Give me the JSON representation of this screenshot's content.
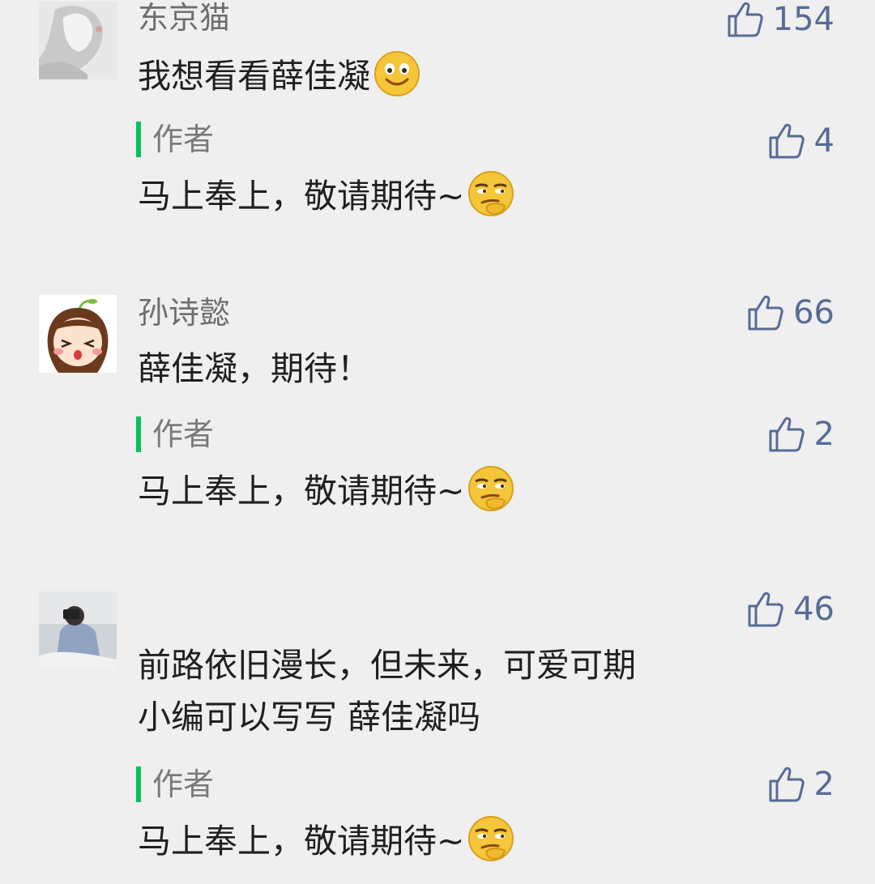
{
  "comments": [
    {
      "username": "东京猫",
      "likes": "154",
      "text": "我想看看薛佳凝",
      "emoji": "smile-emoji",
      "reply": {
        "label": "作者",
        "likes": "4",
        "text": "马上奉上，敬请期待~",
        "emoji": "smirk-emoji"
      }
    },
    {
      "username": "孙诗懿",
      "likes": "66",
      "text": "薛佳凝，期待！",
      "reply": {
        "label": "作者",
        "likes": "2",
        "text": "马上奉上，敬请期待~",
        "emoji": "smirk-emoji"
      }
    },
    {
      "username": "",
      "likes": "46",
      "text_line1": "前路依旧漫长，但未来，可爱可期",
      "text_line2": "小编可以写写 薛佳凝吗",
      "reply": {
        "label": "作者",
        "likes": "2",
        "text": "马上奉上，敬请期待~",
        "emoji": "smirk-emoji"
      }
    }
  ],
  "colors": {
    "like": "#576b95",
    "reply_bar": "#07c160",
    "background": "#efefef"
  }
}
